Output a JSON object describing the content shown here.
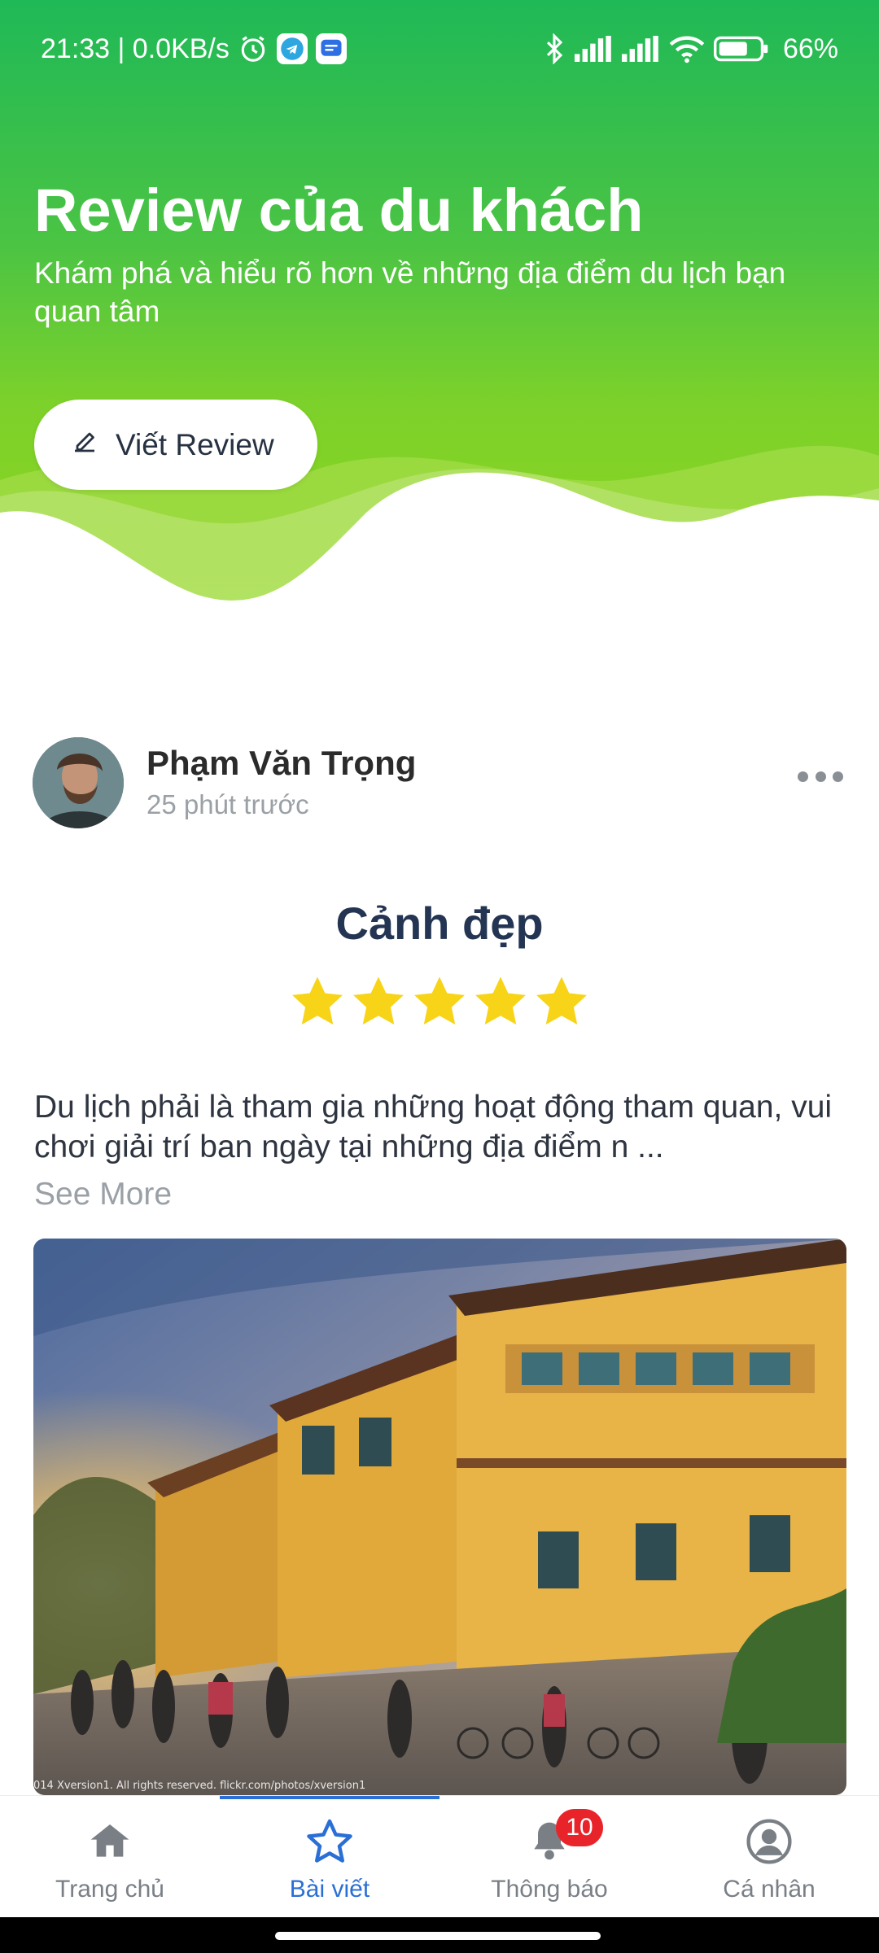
{
  "status_bar": {
    "time_speed": "21:33 | 0.0KB/s",
    "battery": "66%",
    "icons": [
      "alarm-icon",
      "telegram-icon",
      "message-icon",
      "bluetooth-icon",
      "signal-icon",
      "signal-icon",
      "wifi-icon",
      "battery-icon"
    ]
  },
  "header": {
    "title": "Review của du khách",
    "subtitle": "Khám phá và hiểu rõ hơn về những địa điểm du lịch bạn quan tâm",
    "write_button": {
      "label": "Viết Review",
      "icon": "pencil-icon"
    }
  },
  "post": {
    "author": "Phạm Văn Trọng",
    "time": "25 phút trước",
    "title": "Cảnh đẹp",
    "rating": 5,
    "rating_max": 5,
    "text": "Du lịch phải là tham gia những hoạt động tham quan, vui chơi giải trí ban ngày tại những địa điểm n ...",
    "see_more": "See More",
    "photo_caption": "014 Xversion1. All rights reserved. flickr.com/photos/xversion1"
  },
  "bottom_nav": {
    "items": [
      {
        "label": "Trang chủ",
        "icon": "home-icon"
      },
      {
        "label": "Bài viết",
        "icon": "star-icon"
      },
      {
        "label": "Thông báo",
        "icon": "bell-icon",
        "badge": "10"
      },
      {
        "label": "Cá nhân",
        "icon": "user-icon"
      }
    ],
    "active_index": 1
  },
  "colors": {
    "header_top": "#1fb957",
    "header_bottom": "#8fd520",
    "title_dark": "#243553",
    "star": "#f7d417",
    "nav_active": "#2a6fd6",
    "badge": "#e8242a"
  }
}
